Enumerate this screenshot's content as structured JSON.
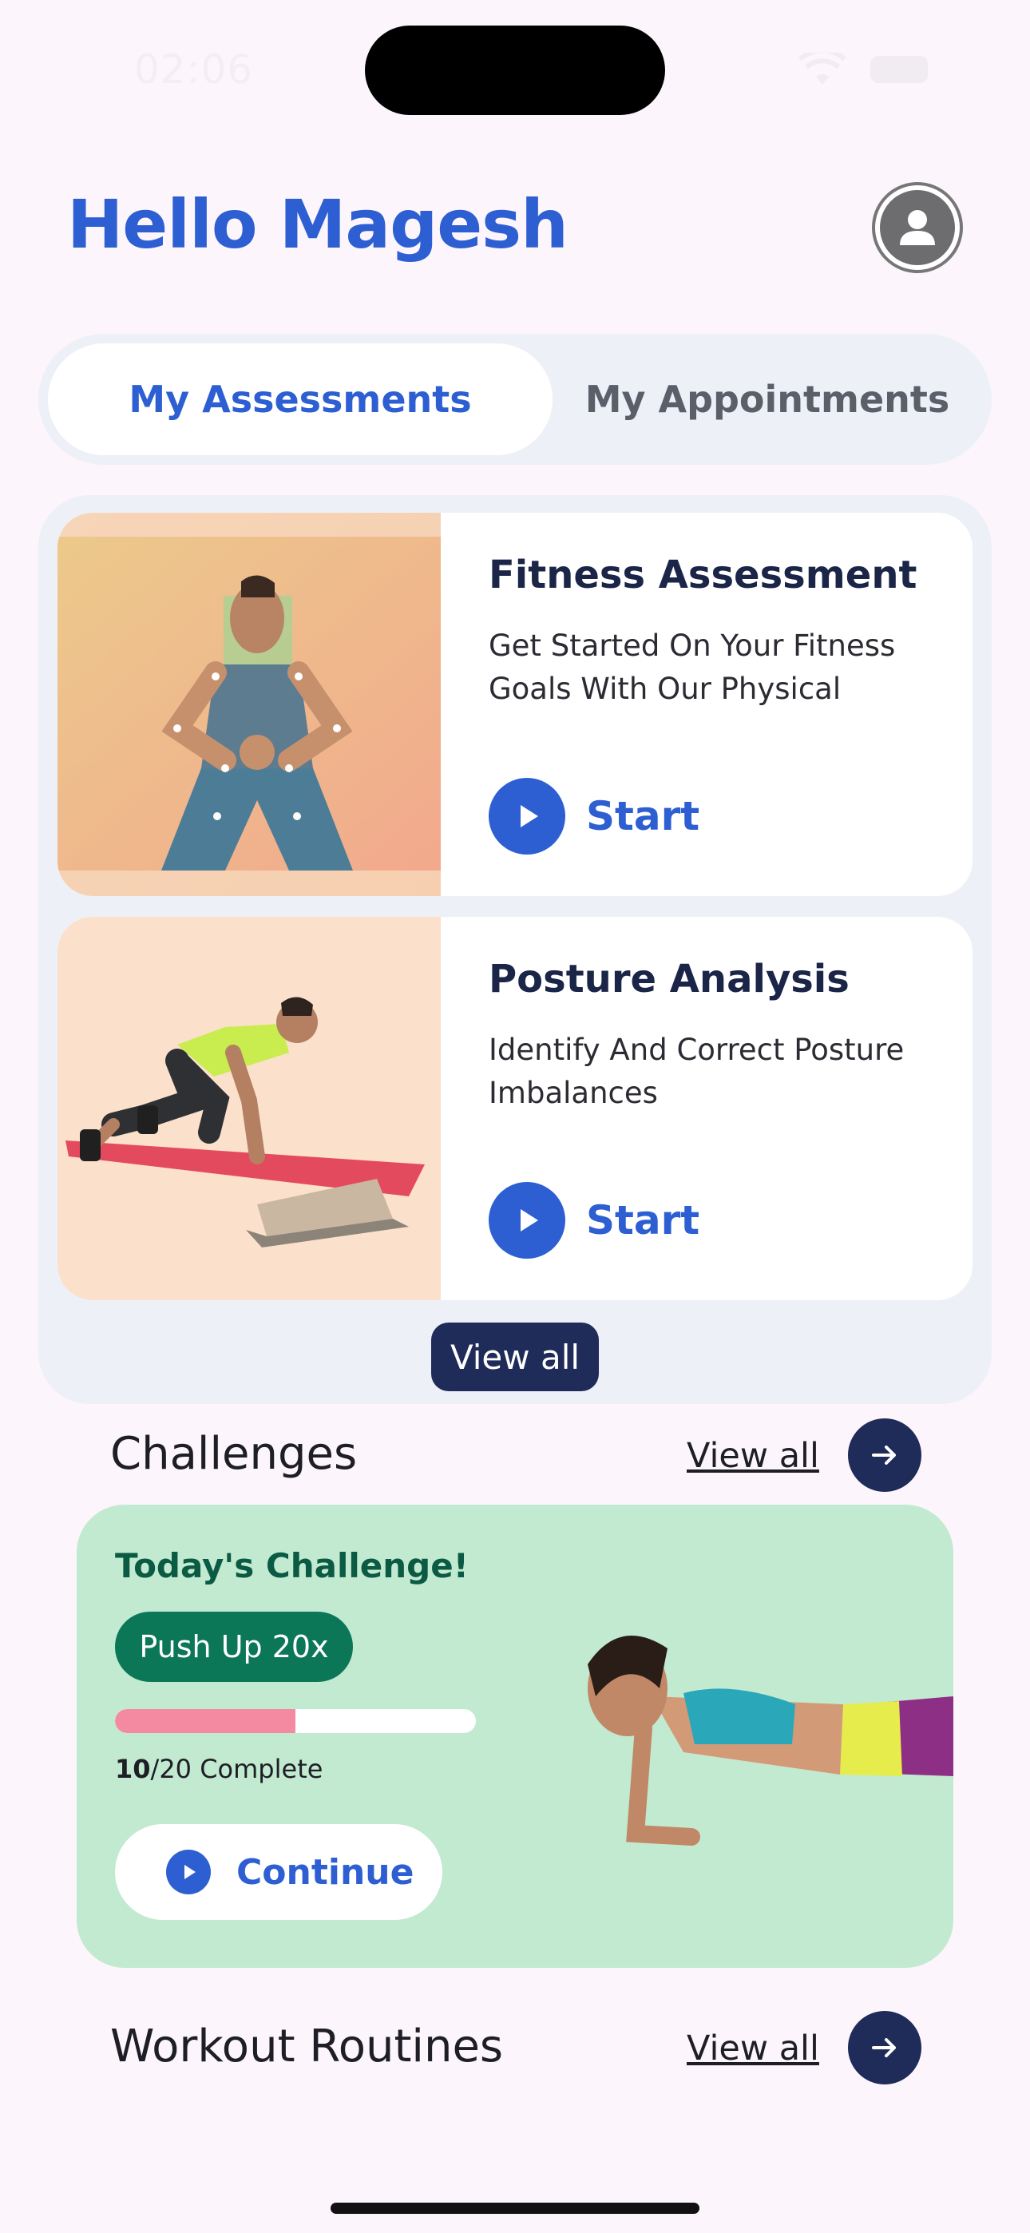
{
  "status_bar": {
    "time": "02:06"
  },
  "header": {
    "greeting": "Hello Magesh"
  },
  "tabs": [
    {
      "label": "My Assessments",
      "active": true
    },
    {
      "label": "My Appointments",
      "active": false
    }
  ],
  "assessments": [
    {
      "title": "Fitness Assessment",
      "description": "Get Started On Your Fitness Goals With Our Physical",
      "action": "Start"
    },
    {
      "title": "Posture Analysis",
      "description": "Identify And Correct Posture Imbalances",
      "action": "Start"
    }
  ],
  "assessments_view_all": "View all",
  "challenges": {
    "section_title": "Challenges",
    "view_all": "View all",
    "card": {
      "title": "Today's Challenge!",
      "badge": "Push Up 20x",
      "completed": "10",
      "total": "/20 Complete",
      "progress": 0.5,
      "action": "Continue"
    }
  },
  "workouts": {
    "section_title": "Workout Routines",
    "view_all": "View all"
  },
  "colors": {
    "primary": "#2d5fd3",
    "navy": "#1f2b58",
    "challenge_bg": "#c2ead0",
    "progress": "#f48aa2"
  }
}
